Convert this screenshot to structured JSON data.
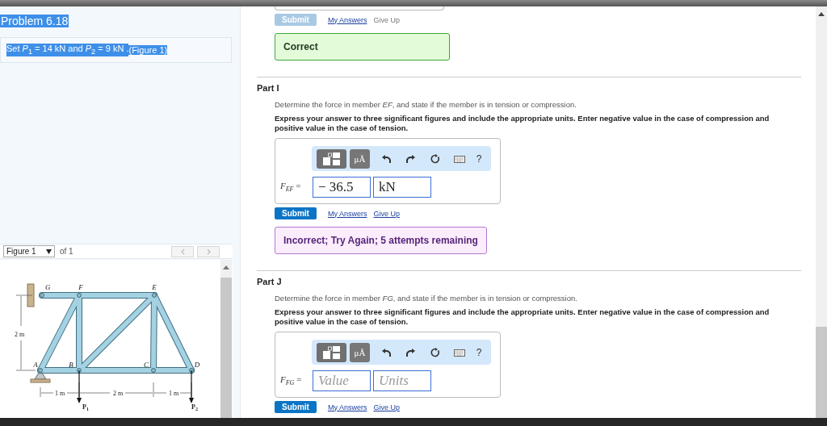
{
  "problem": {
    "title": "Problem 6.18",
    "statement": "Set *P*$_{1}$ = 14 kN and *P*$_{2}$ = 9 kN . ",
    "figure_link": "(Figure 1)",
    "highlighted": true
  },
  "figure": {
    "selector": "Figure 1",
    "count": "of 1",
    "labels": [
      {
        "text": "G"
      },
      {
        "text": "F"
      },
      {
        "text": "E"
      },
      {
        "text": "A"
      },
      {
        "text": "B"
      },
      {
        "text": "C"
      },
      {
        "text": "D"
      },
      {
        "text": "2 m"
      },
      {
        "text": "1 m"
      },
      {
        "text": "2 m"
      },
      {
        "text": "1 m"
      },
      {
        "text": "P",
        "subscript": "1"
      },
      {
        "text": "P",
        "subscript": "2"
      }
    ]
  },
  "previous_part": {
    "actions": [
      {
        "kind": "button",
        "label": "Submit",
        "disabled": true
      },
      {
        "kind": "link",
        "label": "My Answers",
        "disabled": false
      },
      {
        "kind": "link",
        "label": "Give Up",
        "disabled": true
      }
    ],
    "feedback": {
      "kind": "correct",
      "text": "Correct"
    }
  },
  "parts": [
    {
      "title": "Part I",
      "prompt": "Determine the force in member *EF*, and state if the member is in tension or compression.",
      "instructions": "Express your answer to three significant figures and include the appropriate units. Enter negative value in the case of compression and positive value in the case of tension.",
      "toolbar": [
        {
          "kind": "templates"
        },
        {
          "kind": "units",
          "label": "μÅ"
        },
        {
          "kind": "undo"
        },
        {
          "kind": "redo"
        },
        {
          "kind": "reset"
        },
        {
          "kind": "keyboard"
        },
        {
          "kind": "help",
          "label": "?"
        }
      ],
      "variable": "*F*$_{EF}$ =",
      "value_field": {
        "value": "− 36.5"
      },
      "units_field": {
        "value": "kN"
      },
      "actions": [
        {
          "kind": "button",
          "label": "Submit",
          "disabled": false
        },
        {
          "kind": "link",
          "label": "My Answers",
          "disabled": false
        },
        {
          "kind": "link",
          "label": "Give Up",
          "disabled": false
        }
      ],
      "feedback": {
        "kind": "incorrect",
        "text": "Incorrect; Try Again; 5 attempts remaining"
      }
    },
    {
      "title": "Part J",
      "prompt": "Determine the force in member *FG*, and state if the member is in tension or compression.",
      "instructions": "Express your answer to three significant figures and include the appropriate units. Enter negative value in the case of compression and positive value in the case of tension.",
      "toolbar": [
        {
          "kind": "templates"
        },
        {
          "kind": "units",
          "label": "μÅ"
        },
        {
          "kind": "undo"
        },
        {
          "kind": "redo"
        },
        {
          "kind": "reset"
        },
        {
          "kind": "keyboard"
        },
        {
          "kind": "help",
          "label": "?"
        }
      ],
      "variable": "*F*$_{FG}$ =",
      "value_field": {
        "placeholder": "Value"
      },
      "units_field": {
        "placeholder": "Units"
      },
      "actions": [
        {
          "kind": "button",
          "label": "Submit",
          "disabled": false
        },
        {
          "kind": "link",
          "label": "My Answers",
          "disabled": false
        },
        {
          "kind": "link",
          "label": "Give Up",
          "disabled": false
        }
      ]
    }
  ]
}
